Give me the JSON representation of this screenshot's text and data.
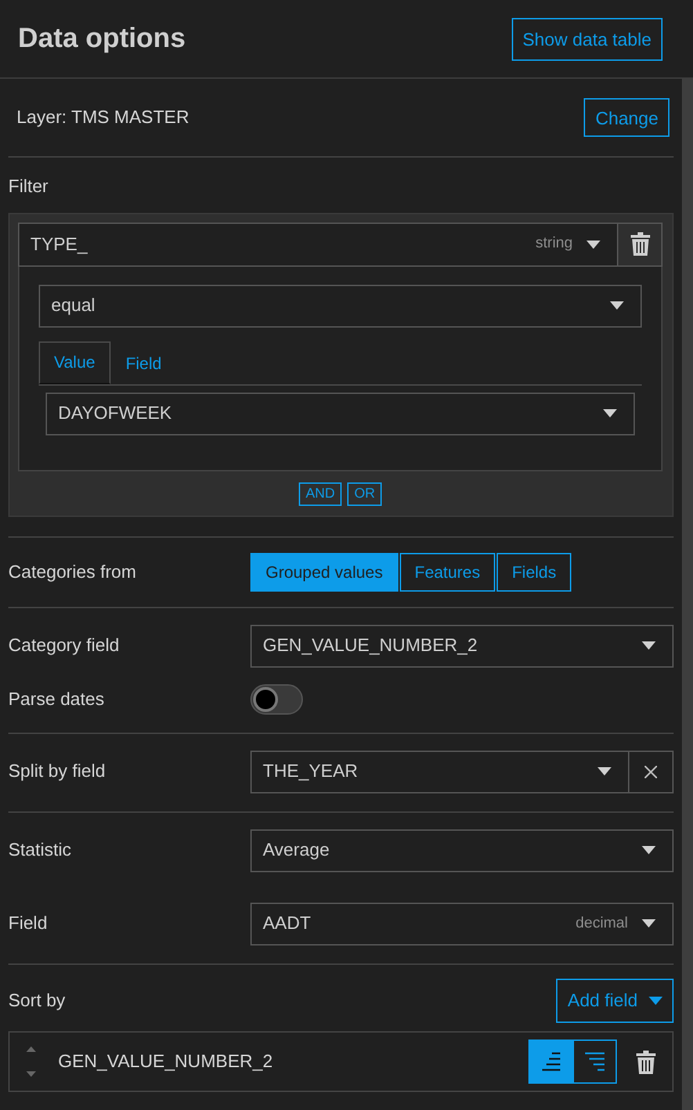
{
  "header": {
    "title": "Data options",
    "show_table_button": "Show data table"
  },
  "layer": {
    "label": "Layer: TMS MASTER",
    "change_button": "Change"
  },
  "filter": {
    "label": "Filter",
    "field": {
      "value": "TYPE_",
      "type": "string"
    },
    "operator": "equal",
    "tabs": [
      {
        "label": "Value",
        "selected": true
      },
      {
        "label": "Field",
        "selected": false
      }
    ],
    "value": "DAYOFWEEK",
    "join_buttons": [
      "AND",
      "OR"
    ]
  },
  "categories_from": {
    "label": "Categories from",
    "options": [
      {
        "label": "Grouped values",
        "selected": true
      },
      {
        "label": "Features",
        "selected": false
      },
      {
        "label": "Fields",
        "selected": false
      }
    ]
  },
  "groups": [
    [
      {
        "kind": "select",
        "label": "Category field",
        "value": "GEN_VALUE_NUMBER_2"
      },
      {
        "kind": "toggle",
        "label": "Parse dates",
        "on": false
      }
    ],
    [
      {
        "kind": "select",
        "label": "Split by field",
        "value": "THE_YEAR",
        "clearable": true
      }
    ],
    [
      {
        "kind": "select",
        "label": "Statistic",
        "value": "Average"
      },
      {
        "kind": "select",
        "label": "Field",
        "value": "AADT",
        "type": "decimal"
      }
    ]
  ],
  "sort": {
    "label": "Sort by",
    "add_button": "Add field",
    "items": [
      {
        "field": "GEN_VALUE_NUMBER_2",
        "ascending": true
      }
    ]
  }
}
